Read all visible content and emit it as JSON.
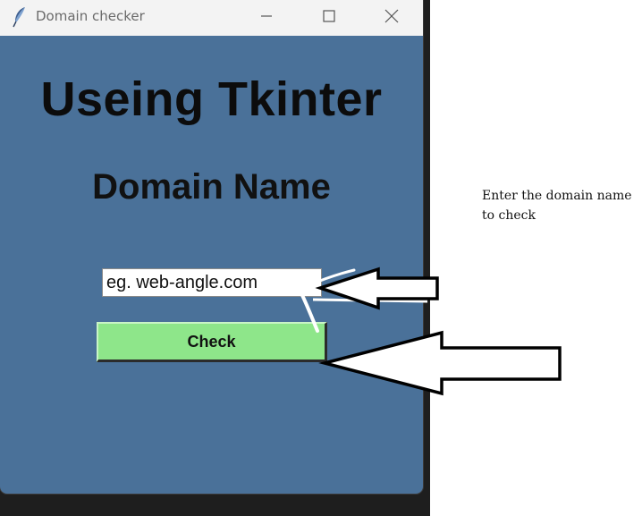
{
  "window": {
    "title": "Domain checker",
    "icon": "feather-icon",
    "controls": [
      "minimize-icon",
      "maximize-icon",
      "close-icon"
    ]
  },
  "main": {
    "heading": "Useing Tkinter",
    "subheading": "Domain Name",
    "input_value": "eg. web-angle.com",
    "button_label": "Check"
  },
  "annotation": {
    "text": "Enter the domain name to check"
  },
  "colors": {
    "window_background": "#4a7199",
    "button_background": "#8ee68a",
    "titlebar": "#f3f3f3"
  }
}
